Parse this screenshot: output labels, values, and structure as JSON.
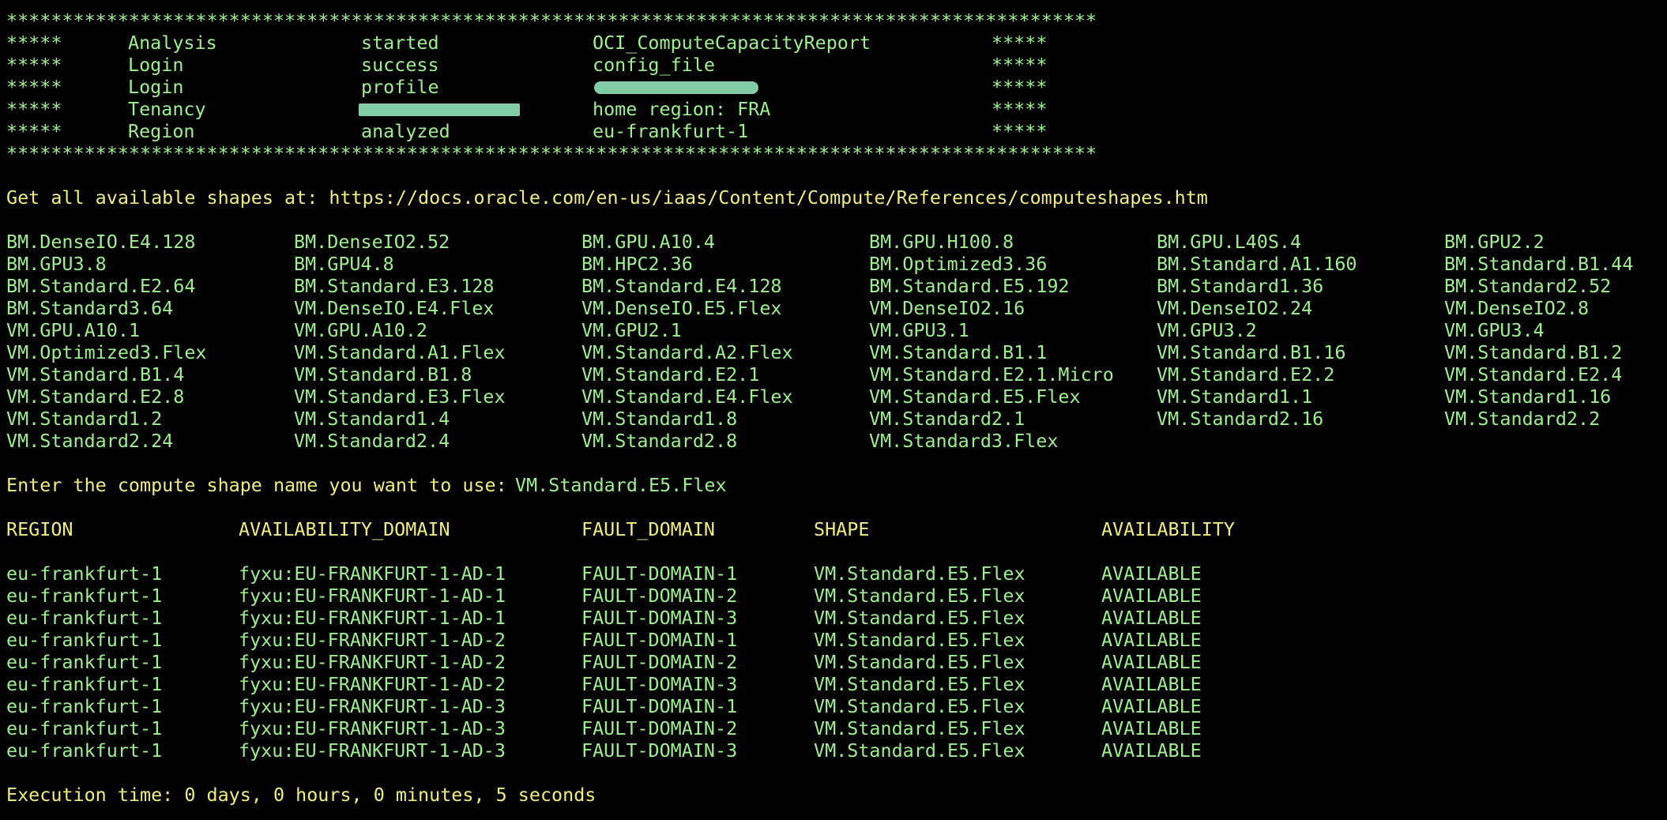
{
  "banner": {
    "border": "**************************************************************************************************",
    "marker": "*****",
    "rows": [
      {
        "a": "Analysis",
        "b": "started",
        "c": "OCI_ComputeCapacityReport"
      },
      {
        "a": "Login",
        "b": "success",
        "c": "config_file"
      },
      {
        "a": "Login",
        "b": "profile",
        "c": ""
      },
      {
        "a": "Tenancy",
        "b": "",
        "c": "home region: FRA"
      },
      {
        "a": "Region",
        "b": "analyzed",
        "c": "eu-frankfurt-1"
      }
    ]
  },
  "shapes_intro": "Get all available shapes at: https://docs.oracle.com/en-us/iaas/Content/Compute/References/computeshapes.htm",
  "shapes": [
    [
      "BM.DenseIO.E4.128",
      "BM.DenseIO2.52",
      "BM.GPU.A10.4",
      "BM.GPU.H100.8",
      "BM.GPU.L40S.4",
      "BM.GPU2.2"
    ],
    [
      "BM.GPU3.8",
      "BM.GPU4.8",
      "BM.HPC2.36",
      "BM.Optimized3.36",
      "BM.Standard.A1.160",
      "BM.Standard.B1.44"
    ],
    [
      "BM.Standard.E2.64",
      "BM.Standard.E3.128",
      "BM.Standard.E4.128",
      "BM.Standard.E5.192",
      "BM.Standard1.36",
      "BM.Standard2.52"
    ],
    [
      "BM.Standard3.64",
      "VM.DenseIO.E4.Flex",
      "VM.DenseIO.E5.Flex",
      "VM.DenseIO2.16",
      "VM.DenseIO2.24",
      "VM.DenseIO2.8"
    ],
    [
      "VM.GPU.A10.1",
      "VM.GPU.A10.2",
      "VM.GPU2.1",
      "VM.GPU3.1",
      "VM.GPU3.2",
      "VM.GPU3.4"
    ],
    [
      "VM.Optimized3.Flex",
      "VM.Standard.A1.Flex",
      "VM.Standard.A2.Flex",
      "VM.Standard.B1.1",
      "VM.Standard.B1.16",
      "VM.Standard.B1.2"
    ],
    [
      "VM.Standard.B1.4",
      "VM.Standard.B1.8",
      "VM.Standard.E2.1",
      "VM.Standard.E2.1.Micro",
      "VM.Standard.E2.2",
      "VM.Standard.E2.4"
    ],
    [
      "VM.Standard.E2.8",
      "VM.Standard.E3.Flex",
      "VM.Standard.E4.Flex",
      "VM.Standard.E5.Flex",
      "VM.Standard1.1",
      "VM.Standard1.16"
    ],
    [
      "VM.Standard1.2",
      "VM.Standard1.4",
      "VM.Standard1.8",
      "VM.Standard2.1",
      "VM.Standard2.16",
      "VM.Standard2.2"
    ],
    [
      "VM.Standard2.24",
      "VM.Standard2.4",
      "VM.Standard2.8",
      "VM.Standard3.Flex",
      "",
      ""
    ]
  ],
  "prompt": {
    "label": "Enter the compute shape name you want to use:",
    "value": "VM.Standard.E5.Flex"
  },
  "results": {
    "headers": [
      "REGION",
      "AVAILABILITY_DOMAIN",
      "FAULT_DOMAIN",
      "SHAPE",
      "AVAILABILITY"
    ],
    "rows": [
      [
        "eu-frankfurt-1",
        "fyxu:EU-FRANKFURT-1-AD-1",
        "FAULT-DOMAIN-1",
        "VM.Standard.E5.Flex",
        "AVAILABLE"
      ],
      [
        "eu-frankfurt-1",
        "fyxu:EU-FRANKFURT-1-AD-1",
        "FAULT-DOMAIN-2",
        "VM.Standard.E5.Flex",
        "AVAILABLE"
      ],
      [
        "eu-frankfurt-1",
        "fyxu:EU-FRANKFURT-1-AD-1",
        "FAULT-DOMAIN-3",
        "VM.Standard.E5.Flex",
        "AVAILABLE"
      ],
      [
        "eu-frankfurt-1",
        "fyxu:EU-FRANKFURT-1-AD-2",
        "FAULT-DOMAIN-1",
        "VM.Standard.E5.Flex",
        "AVAILABLE"
      ],
      [
        "eu-frankfurt-1",
        "fyxu:EU-FRANKFURT-1-AD-2",
        "FAULT-DOMAIN-2",
        "VM.Standard.E5.Flex",
        "AVAILABLE"
      ],
      [
        "eu-frankfurt-1",
        "fyxu:EU-FRANKFURT-1-AD-2",
        "FAULT-DOMAIN-3",
        "VM.Standard.E5.Flex",
        "AVAILABLE"
      ],
      [
        "eu-frankfurt-1",
        "fyxu:EU-FRANKFURT-1-AD-3",
        "FAULT-DOMAIN-1",
        "VM.Standard.E5.Flex",
        "AVAILABLE"
      ],
      [
        "eu-frankfurt-1",
        "fyxu:EU-FRANKFURT-1-AD-3",
        "FAULT-DOMAIN-2",
        "VM.Standard.E5.Flex",
        "AVAILABLE"
      ],
      [
        "eu-frankfurt-1",
        "fyxu:EU-FRANKFURT-1-AD-3",
        "FAULT-DOMAIN-3",
        "VM.Standard.E5.Flex",
        "AVAILABLE"
      ]
    ]
  },
  "execution_time": "Execution time: 0 days, 0 hours, 0 minutes, 5 seconds",
  "colors": {
    "background": "#000000",
    "green_text": "#9df08d",
    "yellow_text": "#f1ec7e",
    "redaction": "#83cca8"
  }
}
